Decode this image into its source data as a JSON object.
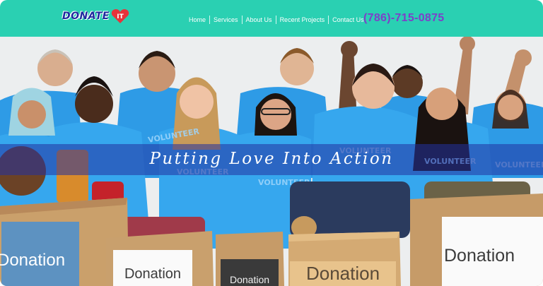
{
  "brand": {
    "logo_text": "DONATE",
    "logo_heart_letter": "IT"
  },
  "nav": {
    "items": [
      {
        "label": "Home"
      },
      {
        "label": "Services"
      },
      {
        "label": "About Us"
      },
      {
        "label": "Recent Projects"
      },
      {
        "label": "Contact Us"
      }
    ]
  },
  "contact": {
    "phone": "(786)-715-0875"
  },
  "hero": {
    "tagline": "Putting Love Into Action",
    "shirt_text": "VOLUNTEER",
    "box_labels": [
      "Donation",
      "Donation",
      "Donation",
      "Donation",
      "Donation"
    ]
  },
  "colors": {
    "header_bg": "#2ad0b2",
    "phone": "#7e3fc9",
    "band": "#2332a0",
    "shirt": "#2e9be6"
  }
}
